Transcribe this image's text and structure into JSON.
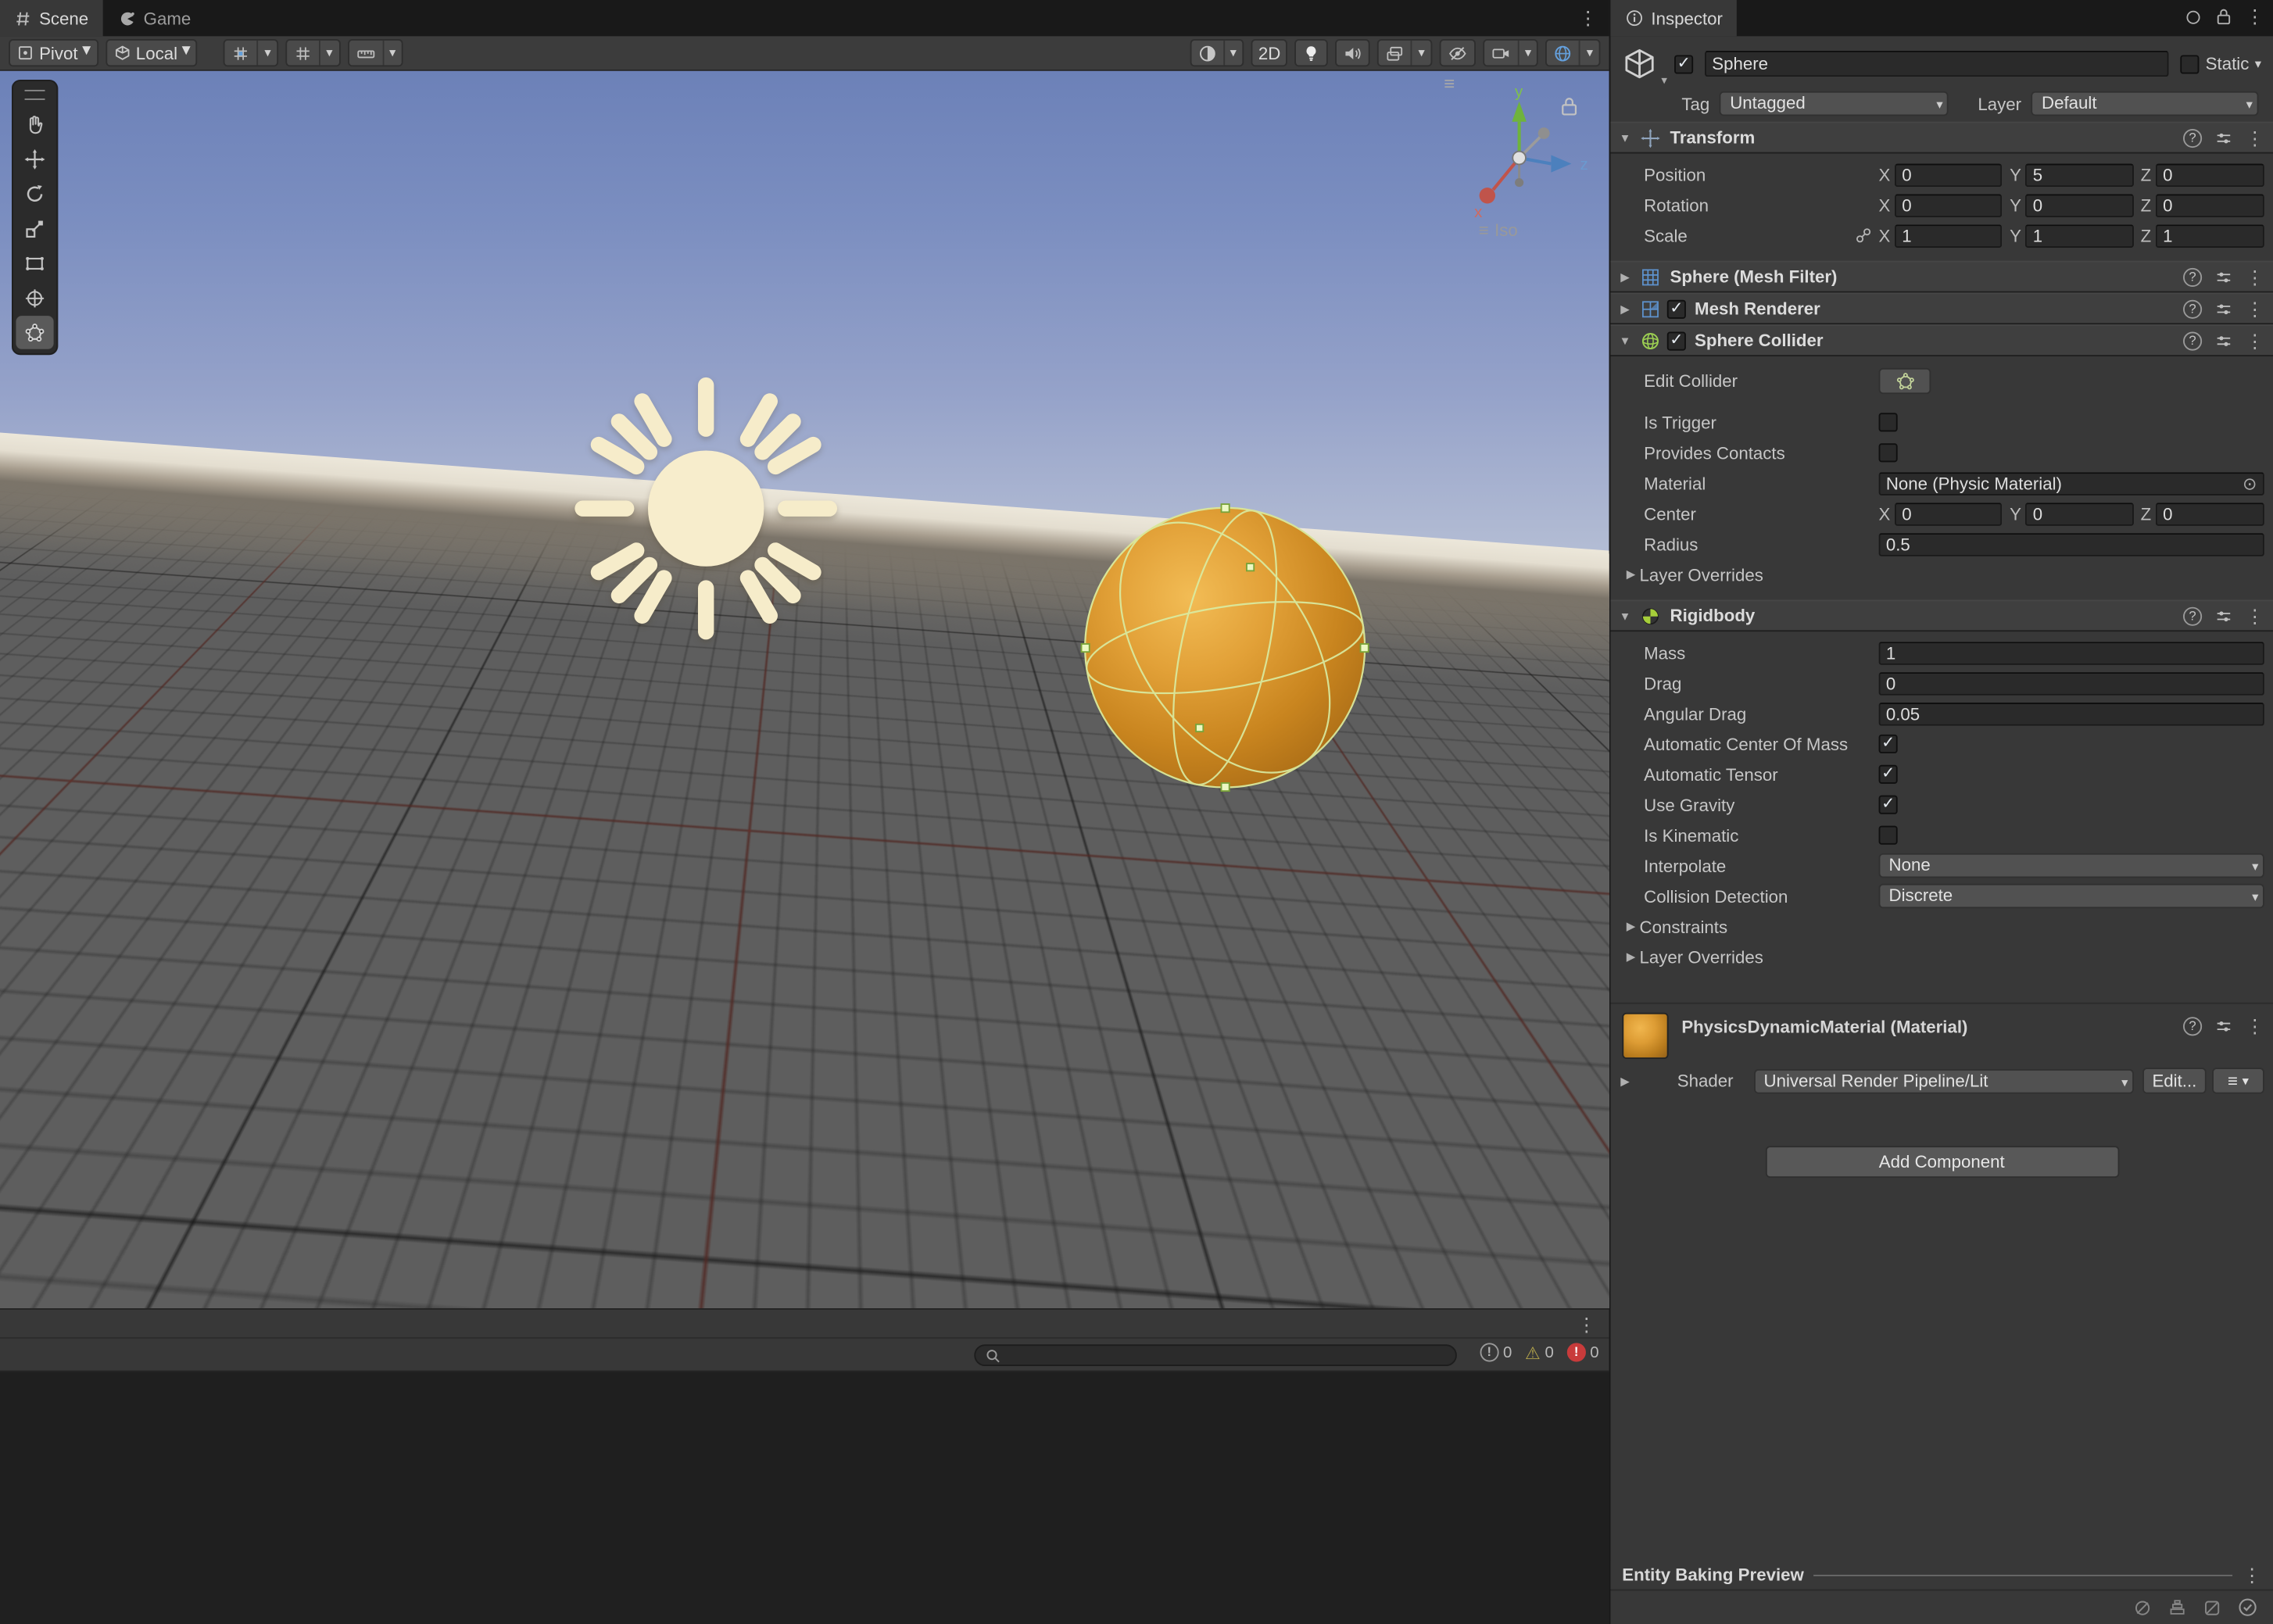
{
  "icons": {
    "menu": "⋮",
    "dropdown": "▾",
    "fold_open": "▼",
    "fold_closed": "▶",
    "check": "✓",
    "help": "?",
    "picker": "⊙",
    "grip": "≡",
    "warning": "⚠",
    "excl": "!"
  },
  "left": {
    "tabs": [
      {
        "label": "Scene"
      },
      {
        "label": "Game"
      }
    ]
  },
  "toolbar": {
    "pivot": "Pivot",
    "local": "Local",
    "two_d": "2D"
  },
  "viewport": {
    "iso": "Iso",
    "axes": {
      "x": "x",
      "y": "y",
      "z": "z"
    }
  },
  "console": {
    "info": "0",
    "warnings": "0",
    "errors": "0"
  },
  "axis": {
    "x": "X",
    "y": "Y",
    "z": "Z"
  },
  "inspector": {
    "tab": "Inspector",
    "name": "Sphere",
    "static_label": "Static",
    "tag_label": "Tag",
    "tag": "Untagged",
    "layer_label": "Layer",
    "layer": "Default",
    "transform": {
      "title": "Transform",
      "position_label": "Position",
      "rotation_label": "Rotation",
      "scale_label": "Scale",
      "position": {
        "x": "0",
        "y": "5",
        "z": "0"
      },
      "rotation": {
        "x": "0",
        "y": "0",
        "z": "0"
      },
      "scale": {
        "x": "1",
        "y": "1",
        "z": "1"
      }
    },
    "mesh_filter": {
      "title": "Sphere (Mesh Filter)"
    },
    "mesh_renderer": {
      "title": "Mesh Renderer"
    },
    "collider": {
      "title": "Sphere Collider",
      "edit": "Edit Collider",
      "is_trigger": "Is Trigger",
      "provides_contacts": "Provides Contacts",
      "material_label": "Material",
      "material": "None (Physic Material)",
      "center_label": "Center",
      "center": {
        "x": "0",
        "y": "0",
        "z": "0"
      },
      "radius_label": "Radius",
      "radius": "0.5",
      "layer_overrides": "Layer Overrides"
    },
    "rigidbody": {
      "title": "Rigidbody",
      "mass_label": "Mass",
      "mass": "1",
      "drag_label": "Drag",
      "drag": "0",
      "angular_drag_label": "Angular Drag",
      "angular_drag": "0.05",
      "auto_com": "Automatic Center Of Mass",
      "auto_tensor": "Automatic Tensor",
      "use_gravity": "Use Gravity",
      "is_kinematic": "Is Kinematic",
      "interpolate_label": "Interpolate",
      "interpolate": "None",
      "collision_label": "Collision Detection",
      "collision": "Discrete",
      "constraints": "Constraints",
      "layer_overrides": "Layer Overrides"
    },
    "material": {
      "title": "PhysicsDynamicMaterial (Material)",
      "shader_label": "Shader",
      "shader": "Universal Render Pipeline/Lit",
      "edit": "Edit..."
    },
    "add_component": "Add Component",
    "entity_baking": "Entity Baking Preview"
  }
}
